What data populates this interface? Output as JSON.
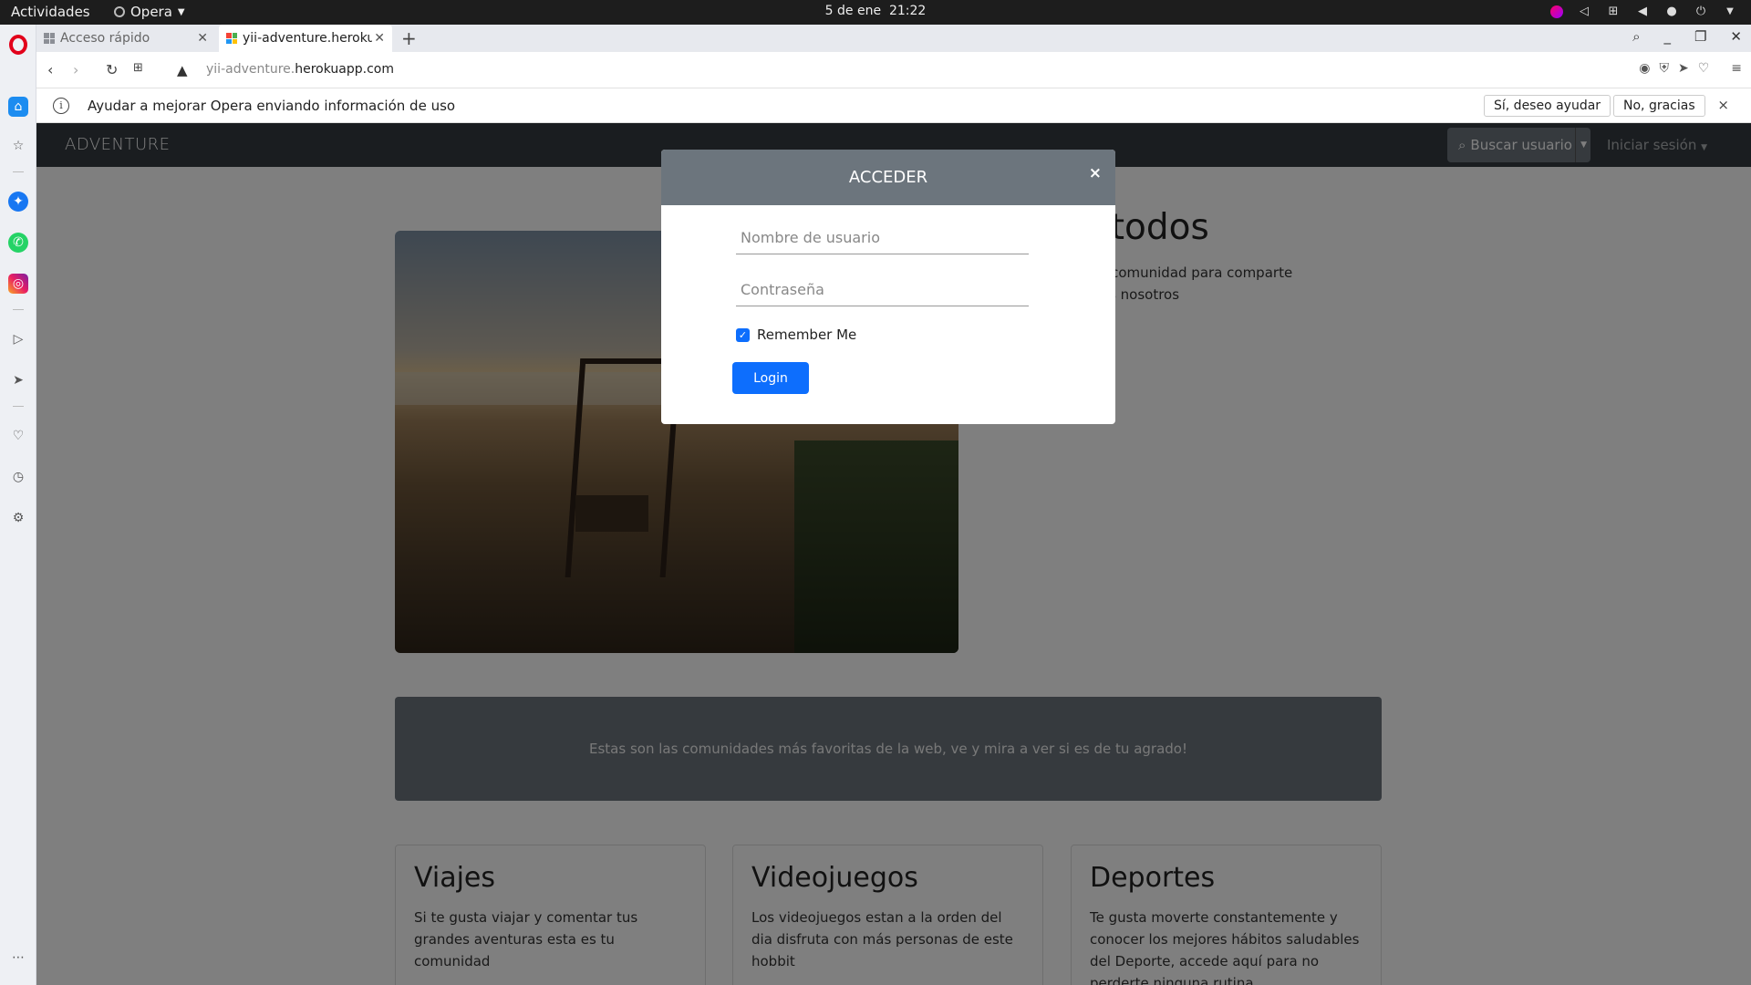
{
  "system_bar": {
    "activities": "Actividades",
    "app_menu": "Opera",
    "date": "5 de ene",
    "time": "21:22"
  },
  "tabs": [
    {
      "label": "Acceso rápido",
      "active": false
    },
    {
      "label": "yii-adventure.herokuapp.com",
      "active": true
    }
  ],
  "address_bar": {
    "url_sub": "yii-adventure.",
    "url_domain": "herokuapp.com"
  },
  "infobar": {
    "message": "Ayudar a mejorar Opera enviando información de uso",
    "accept_label": "Sí, deseo ayudar",
    "decline_label": "No, gracias",
    "close_label": "×"
  },
  "navbar": {
    "brand": "ADVENTURE",
    "search_label": "Buscar usuario",
    "login_label": "Iniciar sesión"
  },
  "hero": {
    "title": "es para todos",
    "text": "s formar parte de la comunidad para comparte tus ideas a con todos nosotros"
  },
  "jumbotron": {
    "text": "Estas son las comunidades más favoritas de la web, ve y mira a ver si es de tu agrado!"
  },
  "cards": [
    {
      "title": "Viajes",
      "text": "Si te gusta viajar y comentar tus grandes aventuras esta es tu comunidad"
    },
    {
      "title": "Videojuegos",
      "text": "Los videojuegos estan a la orden del dia disfruta con más personas de este hobbit"
    },
    {
      "title": "Deportes",
      "text": "Te gusta moverte constantemente y conocer los mejores hábitos saludables del Deporte, accede aquí para no perderte ninguna rutina"
    }
  ],
  "modal": {
    "title": "ACCEDER",
    "close_label": "×",
    "username_placeholder": "Nombre de usuario",
    "password_placeholder": "Contraseña",
    "remember_label": "Remember Me",
    "remember_checked": true,
    "login_label": "Login"
  },
  "colors": {
    "navbar": "#343a40",
    "modal_header": "#6c757d",
    "primary": "#0d6efd",
    "opera_red": "#e2001a"
  }
}
